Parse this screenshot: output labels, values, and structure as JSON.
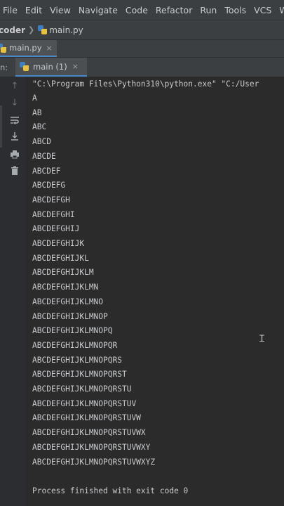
{
  "menu": [
    "File",
    "Edit",
    "View",
    "Navigate",
    "Code",
    "Refactor",
    "Run",
    "Tools",
    "VCS",
    "Window"
  ],
  "breadcrumb": {
    "project": "coder",
    "file": "main.py"
  },
  "editor_tab": {
    "label": "main.py",
    "close": "×"
  },
  "run_panel": {
    "label": "n:",
    "tab_label": "main (1)",
    "close": "×"
  },
  "console": {
    "command": "\"C:\\Program Files\\Python310\\python.exe\" \"C:/User",
    "lines": [
      "A",
      "AB",
      "ABC",
      "ABCD",
      "ABCDE",
      "ABCDEF",
      "ABCDEFG",
      "ABCDEFGH",
      "ABCDEFGHI",
      "ABCDEFGHIJ",
      "ABCDEFGHIJK",
      "ABCDEFGHIJKL",
      "ABCDEFGHIJKLM",
      "ABCDEFGHIJKLMN",
      "ABCDEFGHIJKLMNO",
      "ABCDEFGHIJKLMNOP",
      "ABCDEFGHIJKLMNOPQ",
      "ABCDEFGHIJKLMNOPQR",
      "ABCDEFGHIJKLMNOPQRS",
      "ABCDEFGHIJKLMNOPQRST",
      "ABCDEFGHIJKLMNOPQRSTU",
      "ABCDEFGHIJKLMNOPQRSTUV",
      "ABCDEFGHIJKLMNOPQRSTUVW",
      "ABCDEFGHIJKLMNOPQRSTUVWX",
      "ABCDEFGHIJKLMNOPQRSTUVWXY",
      "ABCDEFGHIJKLMNOPQRSTUVWXYZ"
    ],
    "exit_message": "Process finished with exit code 0"
  },
  "icons": {
    "rerun": "up-arrow-icon",
    "down": "down-arrow-icon",
    "wrap": "soft-wrap-icon",
    "scroll_end": "scroll-to-end-icon",
    "print": "print-icon",
    "trash": "trash-icon"
  },
  "colors": {
    "menu_bg": "#3c3f41",
    "console_bg": "#2b2b2b",
    "tab_underline": "#4a88c7"
  }
}
